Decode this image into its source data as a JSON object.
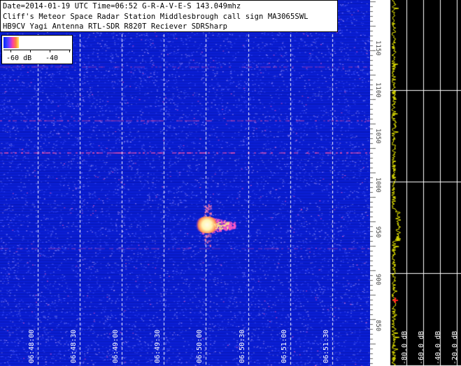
{
  "header": {
    "line1": "Date=2014-01-19 UTC Time=06:52 G-R-A-V-E-S  143.049mhz",
    "line2": "Cliff's Meteor Space Radar Station Middlesbrough call sign MA3065SWL",
    "line3": "HB9CV Yagi Antenna RTL-SDR R820T Reciever SDRSharp"
  },
  "legend": {
    "low_label": "-60 dB",
    "high_label": "-40"
  },
  "time_axis": {
    "labels": [
      "06:48:00",
      "06:48:30",
      "06:49:00",
      "06:49:30",
      "06:50:00",
      "06:50:30",
      "06:51:00",
      "06:51:30"
    ]
  },
  "frequency_axis": {
    "labels": [
      "1150",
      "1100",
      "1050",
      "1000",
      "950",
      "900",
      "850"
    ]
  },
  "spectrum_axis": {
    "labels": [
      "-80.0 dB",
      "-60.0 dB",
      "-40.0 dB",
      "-20.0 dB"
    ]
  },
  "colors": {
    "waterfall_background": "#0b1fd6",
    "meteor_core": "#fff6b0",
    "spectrum_trace": "#e6e600",
    "grid_line": "#ffffff",
    "marker": "#ff2020"
  },
  "icons": {
    "marker": "red-cross-marker"
  }
}
